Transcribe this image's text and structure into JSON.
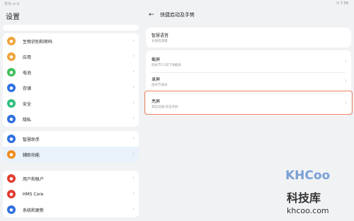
{
  "status": {
    "left": "华为 ⊙ ⊙",
    "right": "⏻ 7:58"
  },
  "left": {
    "title": "设置",
    "groups": [
      {
        "items": [
          {
            "label": "生物识别和密码",
            "icon": "key-icon",
            "color": "#f0a33b"
          },
          {
            "label": "应用",
            "icon": "apps-icon",
            "color": "#f0a33b"
          },
          {
            "label": "电池",
            "icon": "battery-icon",
            "color": "#3fbf5a"
          },
          {
            "label": "存储",
            "icon": "storage-icon",
            "color": "#2f6fe0"
          },
          {
            "label": "安全",
            "icon": "shield-icon",
            "color": "#2bbf7b"
          },
          {
            "label": "隐私",
            "icon": "privacy-icon",
            "color": "#2f6fe0"
          }
        ]
      },
      {
        "items": [
          {
            "label": "智慧助手",
            "icon": "assistant-icon",
            "color": "#2f6fe0"
          },
          {
            "label": "辅助功能",
            "icon": "accessibility-icon",
            "color": "#f08a1b",
            "selected": true
          }
        ]
      },
      {
        "items": [
          {
            "label": "用户和帐户",
            "icon": "user-icon",
            "color": "#e23b30"
          },
          {
            "label": "HMS Core",
            "icon": "hms-icon",
            "color": "#e23b30"
          },
          {
            "label": "系统和更新",
            "icon": "system-icon",
            "color": "#2f6fe0"
          }
        ]
      }
    ]
  },
  "right": {
    "title": "快捷启动及手势",
    "items": [
      {
        "title": "智慧语音",
        "subtitle": "长按电源键"
      },
      {
        "title": "截屏",
        "subtitle": "指关节/三指下滑截屏"
      },
      {
        "title": "录屏",
        "subtitle": "指关节录屏"
      },
      {
        "title": "亮屏",
        "subtitle": "拿起设备/双击亮屏",
        "highlight": true
      }
    ]
  },
  "watermark": {
    "logo": "KHCoo",
    "cn": "科技库",
    "url": "khcoo.com"
  }
}
